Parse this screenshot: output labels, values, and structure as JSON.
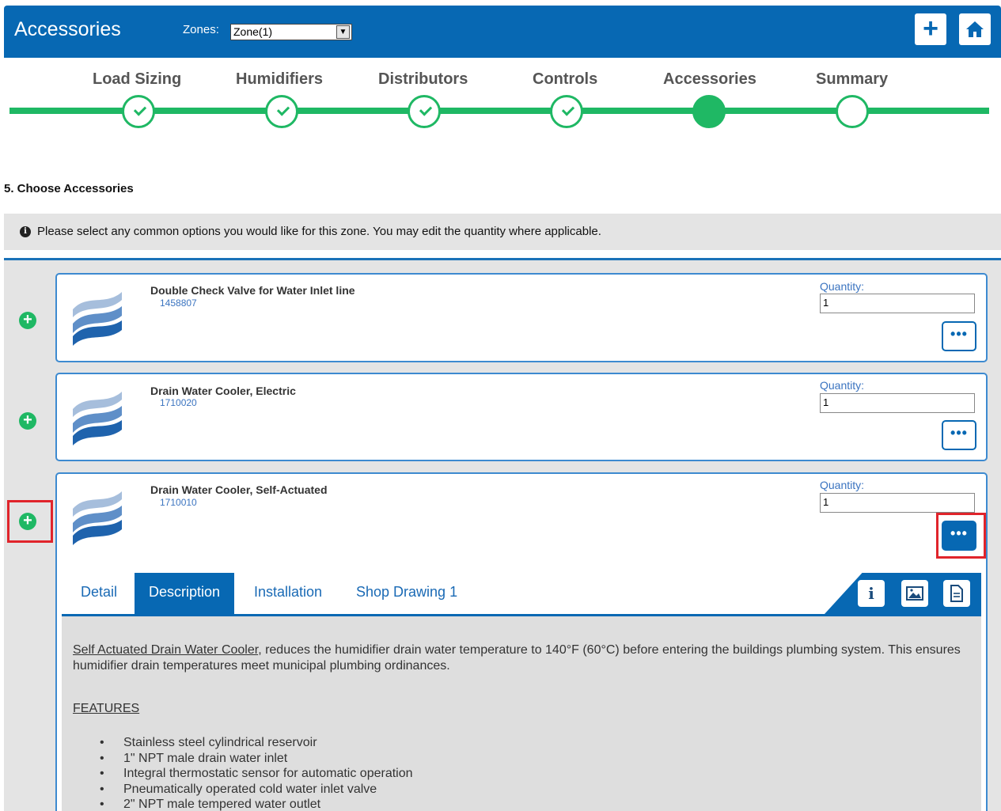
{
  "header": {
    "title": "Accessories",
    "zones_label": "Zones:",
    "zones_selected": "Zone(1)",
    "add_icon": "plus-icon",
    "home_icon": "home-icon"
  },
  "steps": [
    {
      "label": "Load Sizing",
      "status": "complete"
    },
    {
      "label": "Humidifiers",
      "status": "complete"
    },
    {
      "label": "Distributors",
      "status": "complete"
    },
    {
      "label": "Controls",
      "status": "complete"
    },
    {
      "label": "Accessories",
      "status": "current"
    },
    {
      "label": "Summary",
      "status": "pending"
    }
  ],
  "section_title": "5. Choose Accessories",
  "notice": "Please select any common options you would like for this zone. You may edit the quantity where applicable.",
  "items": [
    {
      "name": "Double Check Valve for Water Inlet line",
      "code": "1458807",
      "quantity_label": "Quantity:",
      "quantity": "1",
      "more_label": "•••"
    },
    {
      "name": "Drain Water Cooler, Electric",
      "code": "1710020",
      "quantity_label": "Quantity:",
      "quantity": "1",
      "more_label": "•••"
    },
    {
      "name": "Drain Water Cooler, Self-Actuated",
      "code": "1710010",
      "quantity_label": "Quantity:",
      "quantity": "1",
      "more_label": "•••"
    }
  ],
  "tabs": [
    {
      "label": "Detail",
      "active": false
    },
    {
      "label": "Description",
      "active": true
    },
    {
      "label": "Installation",
      "active": false
    },
    {
      "label": "Shop Drawing 1",
      "active": false
    }
  ],
  "tab_tools": [
    "info-icon",
    "image-icon",
    "document-icon"
  ],
  "description": {
    "product_link": "Self Actuated Drain Water Cooler",
    "intro": ", reduces the humidifier drain water temperature to 140°F (60°C) before entering the buildings plumbing system. This ensures humidifier drain temperatures meet municipal plumbing ordinances.",
    "features_title": "FEATURES",
    "features": [
      "Stainless steel cylindrical reservoir",
      "1\" NPT male drain water inlet",
      "Integral thermostatic sensor for automatic operation",
      "Pneumatically operated cold water inlet valve",
      "2\" NPT male tempered water outlet"
    ]
  },
  "colors": {
    "primary": "#0768b3",
    "success": "#1fb864",
    "highlight": "#e0242b"
  }
}
